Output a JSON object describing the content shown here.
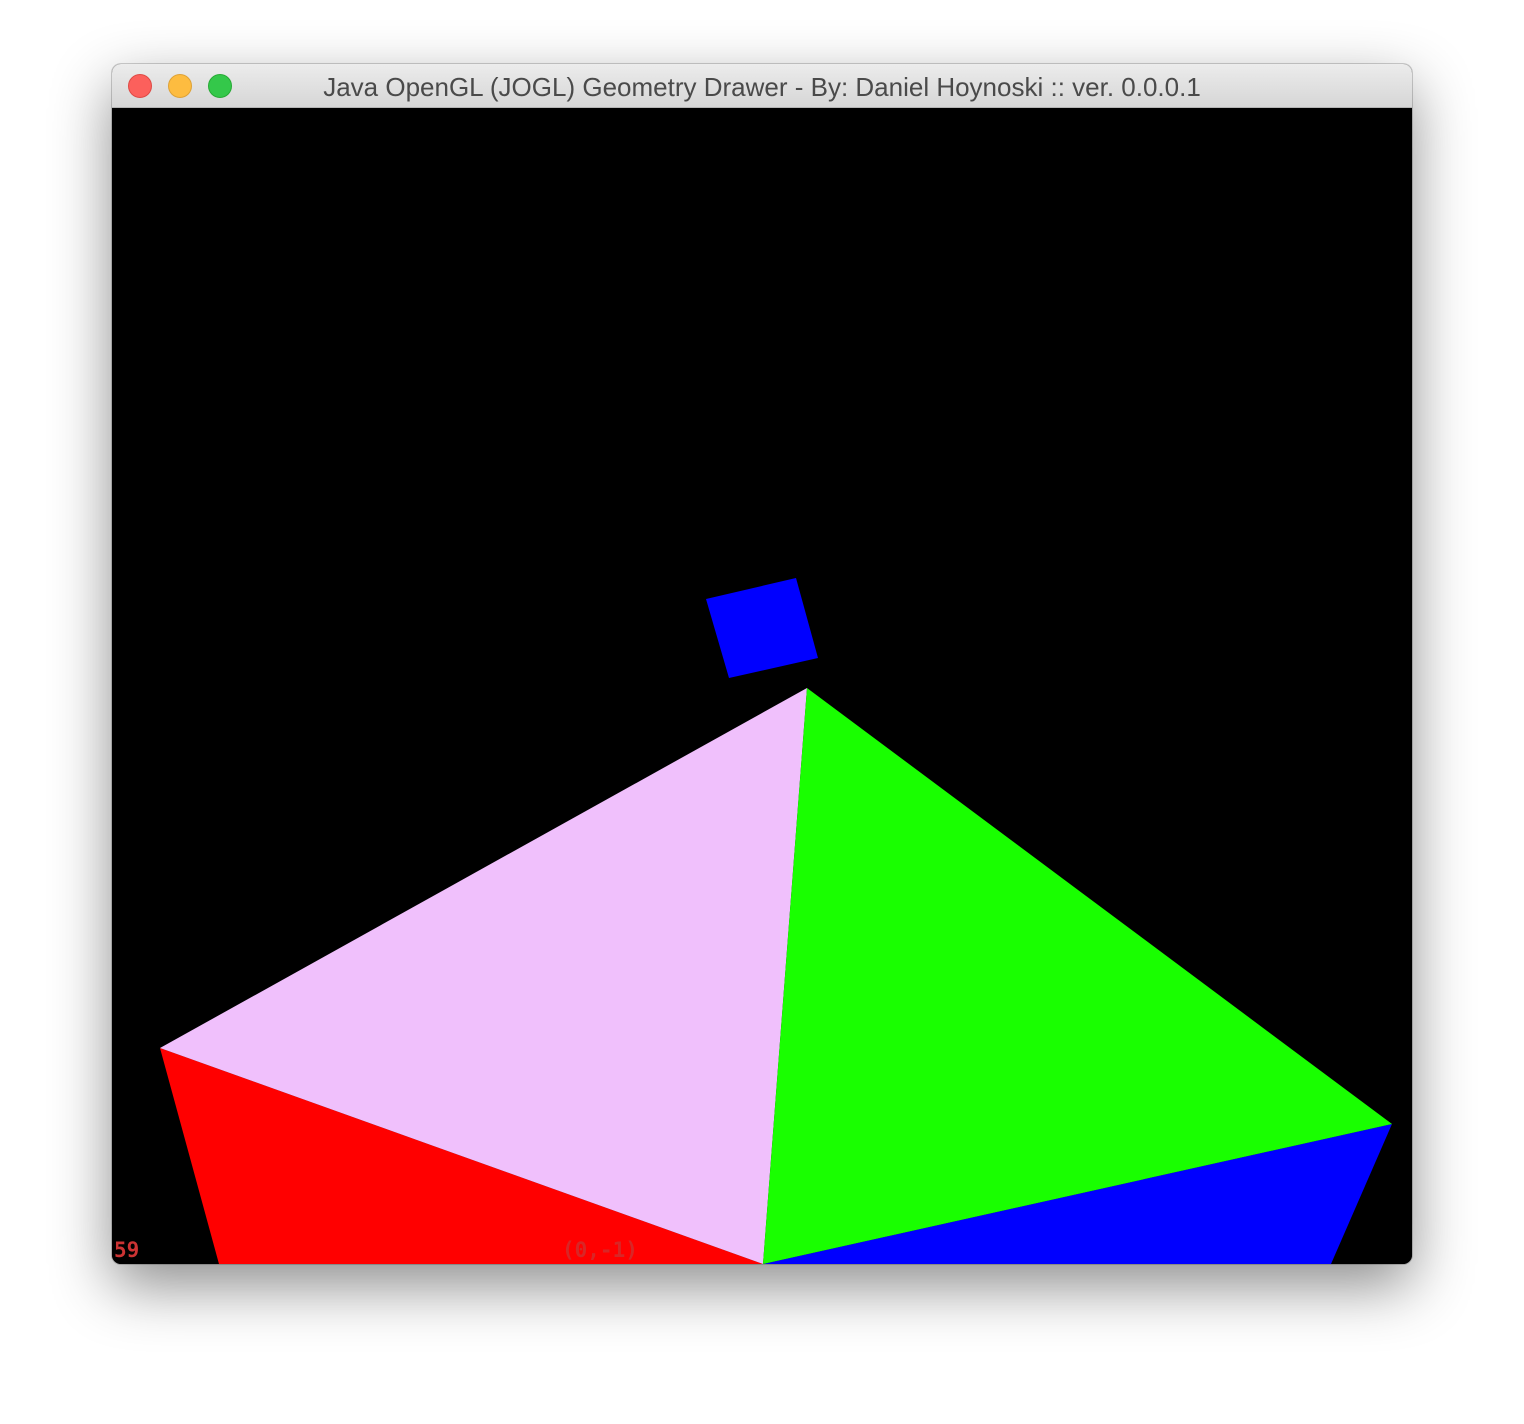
{
  "window": {
    "title": "Java OpenGL (JOGL) Geometry Drawer - By: Daniel Hoynoski :: ver. 0.0.0.1"
  },
  "titlebar_buttons": {
    "close_icon": "close-icon",
    "minimize_icon": "minimize-icon",
    "zoom_icon": "zoom-icon"
  },
  "canvas": {
    "background_color": "#000000",
    "fps": "59",
    "coordinates": "(0,-1)",
    "text_color": "#cc3333",
    "shapes": {
      "pink_triangle": "#f0c0fc",
      "green_triangle": "#19ff00",
      "red_triangle": "#ff0000",
      "blue_triangle": "#0000ff",
      "blue_square": "#0000ff"
    }
  }
}
